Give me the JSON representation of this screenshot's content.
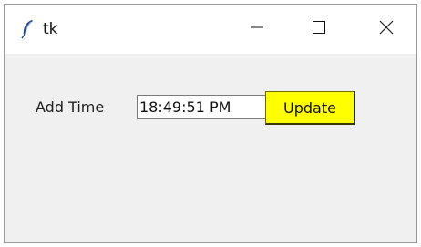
{
  "window": {
    "title": "tk",
    "icon": "feather-icon",
    "controls": {
      "minimize_icon": "minimize-icon",
      "maximize_icon": "maximize-icon",
      "close_icon": "close-icon"
    }
  },
  "form": {
    "label": "Add Time",
    "time_value": "18:49:51 PM",
    "button_label": "Update",
    "button_color": "#ffff00"
  }
}
